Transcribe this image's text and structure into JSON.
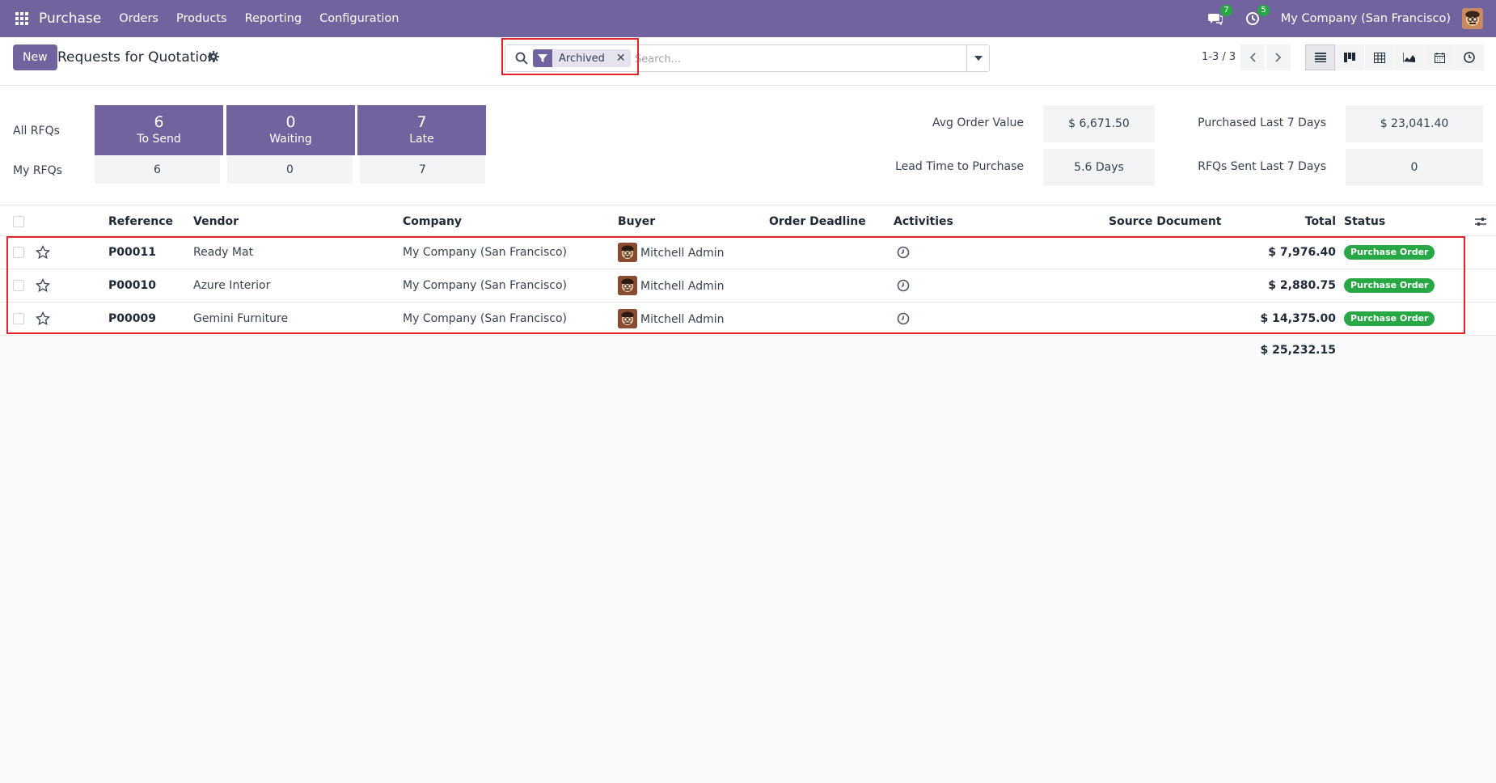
{
  "navbar": {
    "app_name": "Purchase",
    "menu": [
      "Orders",
      "Products",
      "Reporting",
      "Configuration"
    ],
    "messages_count": "7",
    "activities_count": "5",
    "company": "My Company (San Francisco)"
  },
  "control_panel": {
    "new_label": "New",
    "title": "Requests for Quotation",
    "facet_label": "Archived",
    "search_placeholder": "Search...",
    "pager": "1-3 / 3"
  },
  "dashboard": {
    "all_rfqs_label": "All RFQs",
    "my_rfqs_label": "My RFQs",
    "tiles": [
      {
        "count": "6",
        "label": "To Send",
        "my": "6"
      },
      {
        "count": "0",
        "label": "Waiting",
        "my": "0"
      },
      {
        "count": "7",
        "label": "Late",
        "my": "7"
      }
    ],
    "stats": {
      "avg_order_label": "Avg Order Value",
      "avg_order_value": "$ 6,671.50",
      "lead_time_label": "Lead Time to Purchase",
      "lead_time_value": "5.6 Days",
      "purchased_label": "Purchased Last 7 Days",
      "purchased_value": "$ 23,041.40",
      "rfqs_sent_label": "RFQs Sent Last 7 Days",
      "rfqs_sent_value": "0"
    }
  },
  "table": {
    "headers": {
      "reference": "Reference",
      "vendor": "Vendor",
      "company": "Company",
      "buyer": "Buyer",
      "deadline": "Order Deadline",
      "activities": "Activities",
      "source": "Source Document",
      "total": "Total",
      "status": "Status"
    },
    "rows": [
      {
        "reference": "P00011",
        "vendor": "Ready Mat",
        "company": "My Company (San Francisco)",
        "buyer": "Mitchell Admin",
        "total": "$ 7,976.40",
        "status": "Purchase Order"
      },
      {
        "reference": "P00010",
        "vendor": "Azure Interior",
        "company": "My Company (San Francisco)",
        "buyer": "Mitchell Admin",
        "total": "$ 2,880.75",
        "status": "Purchase Order"
      },
      {
        "reference": "P00009",
        "vendor": "Gemini Furniture",
        "company": "My Company (San Francisco)",
        "buyer": "Mitchell Admin",
        "total": "$ 14,375.00",
        "status": "Purchase Order"
      }
    ],
    "grand_total": "$ 25,232.15"
  },
  "colors": {
    "brand": "#71639e",
    "status_green": "#28a745",
    "highlight_red": "#e0242a"
  }
}
